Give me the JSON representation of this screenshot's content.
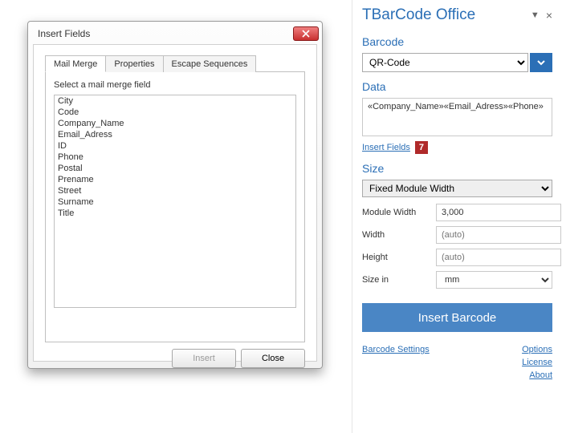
{
  "sidebar": {
    "title": "TBarCode Office",
    "sections": {
      "barcode": {
        "label": "Barcode",
        "selected": "QR-Code"
      },
      "data": {
        "label": "Data",
        "value": "«Company_Name»«Email_Adress»«Phone»",
        "insert_fields_link": "Insert Fields",
        "marker": "7"
      },
      "size": {
        "label": "Size",
        "mode": "Fixed Module Width",
        "module_width": {
          "label": "Module Width",
          "value": "3,000"
        },
        "width": {
          "label": "Width",
          "placeholder": "(auto)"
        },
        "height": {
          "label": "Height",
          "placeholder": "(auto)"
        },
        "size_in": {
          "label": "Size in",
          "value": "mm"
        }
      }
    },
    "insert_button": "Insert Barcode",
    "bottom": {
      "settings": "Barcode Settings",
      "options": "Options",
      "license": "License",
      "about": "About"
    }
  },
  "dialog": {
    "title": "Insert Fields",
    "tabs": [
      "Mail Merge",
      "Properties",
      "Escape Sequences"
    ],
    "active_tab": 0,
    "panel_label": "Select a mail merge field",
    "fields": [
      "City",
      "Code",
      "Company_Name",
      "Email_Adress",
      "ID",
      "Phone",
      "Postal",
      "Prename",
      "Street",
      "Surname",
      "Title"
    ],
    "buttons": {
      "insert": "Insert",
      "close": "Close"
    }
  }
}
